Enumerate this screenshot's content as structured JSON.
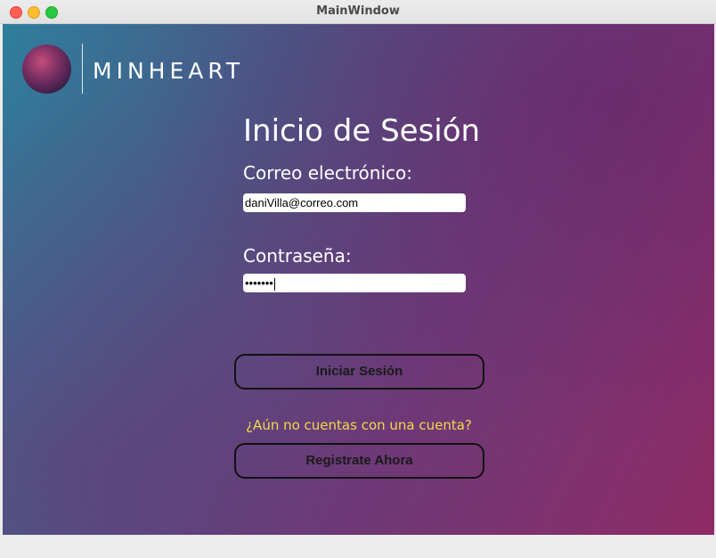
{
  "window": {
    "title": "MainWindow"
  },
  "brand": {
    "name": "MINHEART",
    "logo_icon": "planet-logo-icon"
  },
  "login": {
    "heading": "Inicio de Sesión",
    "email_label": "Correo electrónico:",
    "email_value": "daniVilla@correo.com",
    "password_label": "Contraseña:",
    "password_masked": "•••••••",
    "login_button": "Iniciar Sesión",
    "no_account_link": "¿Aún no cuentas con una cuenta?",
    "register_button": "Registrate Ahora"
  },
  "colors": {
    "gradient_start": "#2f7e9c",
    "gradient_end": "#8f2a66",
    "link_color": "#f2d94a"
  }
}
